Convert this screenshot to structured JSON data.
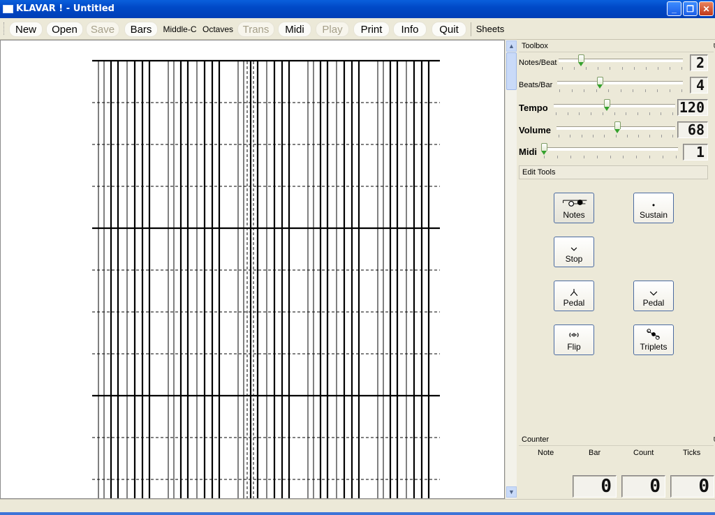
{
  "window": {
    "title": "KLAVAR ! - Untitled",
    "controls": [
      "minimize-icon",
      "restore-icon",
      "close-icon"
    ]
  },
  "toolbar": {
    "buttons": [
      {
        "label": "New",
        "enabled": true
      },
      {
        "label": "Open",
        "enabled": true
      },
      {
        "label": "Save",
        "enabled": false
      },
      {
        "label": "Bars",
        "enabled": true
      },
      {
        "label": "Middle-C",
        "enabled": true
      },
      {
        "label": "Octaves",
        "enabled": true
      },
      {
        "label": "Trans",
        "enabled": false
      },
      {
        "label": "Midi",
        "enabled": true
      },
      {
        "label": "Play",
        "enabled": false
      },
      {
        "label": "Print",
        "enabled": true
      },
      {
        "label": "Info",
        "enabled": true
      },
      {
        "label": "Quit",
        "enabled": true
      },
      {
        "label": "Sheets",
        "enabled": true
      }
    ]
  },
  "toolbox": {
    "title": "Toolbox",
    "sliders": [
      {
        "label": "Notes/Beat",
        "value": "2",
        "level": 0.18
      },
      {
        "label": "Beats/Bar",
        "value": "4",
        "level": 0.34
      },
      {
        "label": "Tempo",
        "value": "120",
        "level": 0.44
      },
      {
        "label": "Volume",
        "value": "68",
        "level": 0.49
      },
      {
        "label": "Midi",
        "value": "1",
        "level": 0.0
      }
    ],
    "edit_tools_label": "Edit Tools",
    "edit_buttons": [
      {
        "label": "Notes",
        "icon": "notes-icon",
        "active": true
      },
      {
        "label": "Sustain",
        "icon": "sustain-dot-icon",
        "active": false
      },
      {
        "label": "Stop",
        "icon": "stop-chevron-icon",
        "active": false
      },
      {
        "label": "Pedal",
        "icon": "pedal-down-icon",
        "active": false
      },
      {
        "label": "Pedal",
        "icon": "pedal-up-icon",
        "active": false
      },
      {
        "label": "Flip",
        "icon": "flip-icon",
        "active": false
      },
      {
        "label": "Triplets",
        "icon": "triplets-icon",
        "active": false
      }
    ]
  },
  "counter": {
    "title": "Counter",
    "columns": [
      "Note",
      "Bar",
      "Count",
      "Ticks"
    ],
    "values": [
      "0",
      "0",
      "0"
    ]
  },
  "colors": {
    "titlebar": "#0049c7",
    "panel": "#ece9d8",
    "slider_tip": "#35a12d"
  }
}
